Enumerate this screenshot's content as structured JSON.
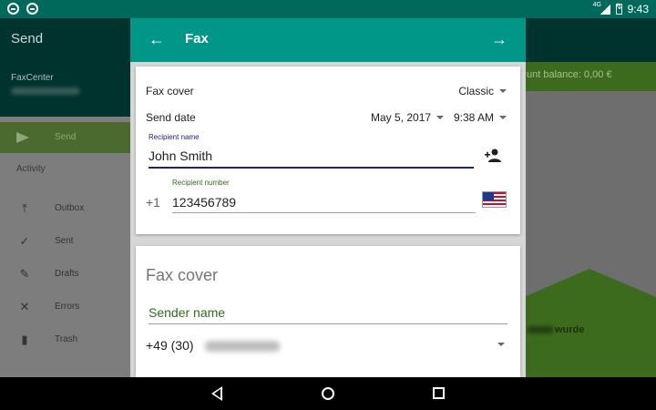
{
  "status_bar": {
    "network": "4G",
    "time": "9:43"
  },
  "background": {
    "title": "Send",
    "account_name": "FaxCenter",
    "balance_text": "unt balance: 0,00 €",
    "drawer": {
      "send_label": "Send",
      "section_label": "Activity",
      "items": [
        {
          "label": "Outbox",
          "icon": "upload-icon"
        },
        {
          "label": "Sent",
          "icon": "check-icon"
        },
        {
          "label": "Drafts",
          "icon": "pencil-icon"
        },
        {
          "label": "Errors",
          "icon": "x-icon"
        },
        {
          "label": "Trash",
          "icon": "trash-icon"
        }
      ]
    },
    "promo_text": "wurde"
  },
  "dialog": {
    "title": "Fax",
    "cover_label": "Fax cover",
    "cover_value": "Classic",
    "send_date_label": "Send date",
    "date_value": "May 5, 2017",
    "time_value": "9:38 AM",
    "recipient_name_label": "Recipient name",
    "recipient_name_value": "John Smith",
    "recipient_number_label": "Recipient number",
    "country_code": "+1",
    "recipient_number_value": "123456789",
    "cover_section_title": "Fax cover",
    "sender_name_placeholder": "Sender name",
    "sender_number_prefix": "+49 (30)"
  },
  "colors": {
    "accent": "#009688",
    "accent_dark": "#00695c",
    "focus_underline": "#1a237e",
    "green_label": "#33691e"
  }
}
